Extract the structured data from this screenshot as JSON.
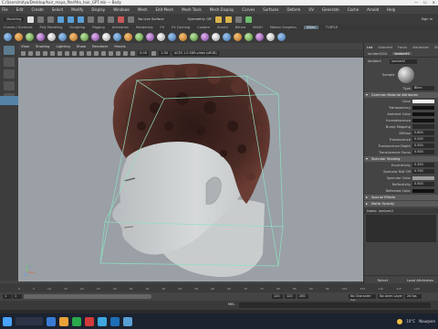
{
  "window": {
    "title": "C:/Users/mitya/Desktop/hair_maya_file/Afro_hair_GPT.mb  ---  Body",
    "controls": [
      "—",
      "☐",
      "✕"
    ]
  },
  "menubar": [
    "File",
    "Edit",
    "Create",
    "Select",
    "Modify",
    "Display",
    "Windows",
    "Mesh",
    "Edit Mesh",
    "Mesh Tools",
    "Mesh Display",
    "Curves",
    "Surfaces",
    "Deform",
    "UV",
    "Generate",
    "Cache",
    "Arnold",
    "Help"
  ],
  "status_line": {
    "mode": "Modeling",
    "no_live_surface": "No Live Surface",
    "symmetry": "Symmetry: Off",
    "sign_in": "Sign In"
  },
  "shelf_tabs": {
    "items": [
      "Curves / Surfaces",
      "Poly Modeling",
      "Sculpting",
      "Rigging",
      "Animation",
      "Rendering",
      "FX",
      "FX Caching",
      "Custom",
      "Arnold",
      "Bifrost",
      "MASH",
      "Motion Graphics",
      "XGen",
      "TURTLE"
    ],
    "active": "XGen"
  },
  "viewport": {
    "menu": [
      "View",
      "Shading",
      "Lighting",
      "Show",
      "Renderer",
      "Panels"
    ],
    "field_a": "0.00",
    "field_b": "1.00",
    "color_space": "ACES 1.0 SDR-video (sRGB)",
    "axis_label": "z"
  },
  "right_panel": {
    "tabs": [
      "List",
      "Selected",
      "Focus",
      "Attributes",
      "Show",
      "Help"
    ],
    "node_tabs": [
      "lambert2SG",
      "lambert2"
    ],
    "active_node_tab": "lambert2",
    "type_label": "lambert:",
    "type_value": "lambert2",
    "sample_label": "Sample",
    "type_row_label": "Type",
    "type_row_value": "Blinn",
    "common_section": "Common Material Attributes",
    "common": [
      {
        "label": "Color",
        "kind": "swatch",
        "color": "#eeeeee"
      },
      {
        "label": "Transparency",
        "kind": "swatch",
        "color": "#111111"
      },
      {
        "label": "Ambient Color",
        "kind": "swatch",
        "color": "#111111"
      },
      {
        "label": "Incandescence",
        "kind": "swatch",
        "color": "#111111"
      },
      {
        "label": "Bump Mapping",
        "kind": "empty"
      },
      {
        "label": "Diffuse",
        "kind": "value",
        "value": "0.800"
      },
      {
        "label": "Translucence",
        "kind": "value",
        "value": "0.000"
      },
      {
        "label": "Translucence Depth",
        "kind": "value",
        "value": "0.500"
      },
      {
        "label": "Translucence Focus",
        "kind": "value",
        "value": "0.500"
      }
    ],
    "specular_section": "Specular Shading",
    "specular": [
      {
        "label": "Eccentricity",
        "kind": "value",
        "value": "0.300"
      },
      {
        "label": "Specular Roll Off",
        "kind": "value",
        "value": "0.700"
      },
      {
        "label": "Specular Color",
        "kind": "swatch",
        "color": "#9a9a9a"
      },
      {
        "label": "Reflectivity",
        "kind": "value",
        "value": "0.500"
      },
      {
        "label": "Reflected Color",
        "kind": "swatch",
        "color": "#111111"
      }
    ],
    "closed_sections": [
      "Special Effects",
      "Matte Opacity"
    ],
    "notes_label": "Notes: lambert2",
    "buttons": [
      "Select",
      "Load Attributes"
    ]
  },
  "timeslider": {
    "ticks": [
      "0",
      "5",
      "10",
      "15",
      "20",
      "25",
      "30",
      "35",
      "40",
      "45",
      "50",
      "55",
      "60",
      "65",
      "70",
      "75",
      "80",
      "85",
      "90",
      "95",
      "100",
      "105",
      "110",
      "115",
      "120"
    ]
  },
  "range": {
    "start": "1",
    "start_inner": "1",
    "end_inner": "120",
    "end": "120",
    "end2": "200",
    "character_set": "No Character Set",
    "anim_layer": "No Anim Layer",
    "fps": "24 fps"
  },
  "command_line": {
    "label": "MEL"
  },
  "taskbar": {
    "weather_temp": "10°C",
    "weather_text": "Nauqvon",
    "app_icon_colors": [
      "#3a7bd5",
      "#e8a23a",
      "#2aa84a",
      "#d13a3a",
      "#3fa7e0",
      "#1e6fb7",
      "#5a9fd4"
    ]
  },
  "colors": {
    "viewport_bg": "#9aa0a6",
    "accent": "#5583a8",
    "hair": "#3a2420",
    "skin": "#cfd2d3",
    "bbox": "#8fe0c0"
  }
}
